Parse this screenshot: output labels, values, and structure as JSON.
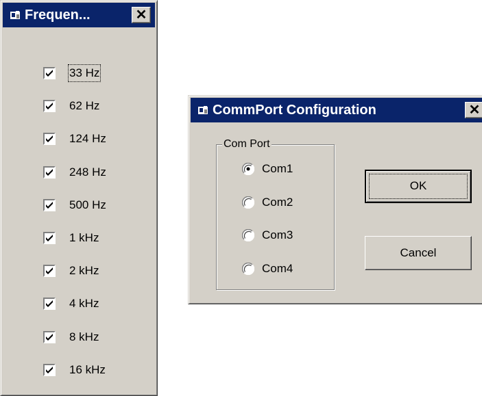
{
  "frequency_window": {
    "title": "Frequen...",
    "items": [
      {
        "label": "33 Hz",
        "checked": true,
        "focused": true
      },
      {
        "label": "62 Hz",
        "checked": true
      },
      {
        "label": "124 Hz",
        "checked": true
      },
      {
        "label": "248 Hz",
        "checked": true
      },
      {
        "label": "500 Hz",
        "checked": true
      },
      {
        "label": "1 kHz",
        "checked": true
      },
      {
        "label": "2 kHz",
        "checked": true
      },
      {
        "label": "4 kHz",
        "checked": true
      },
      {
        "label": "8 kHz",
        "checked": true
      },
      {
        "label": "16 kHz",
        "checked": true
      }
    ]
  },
  "commport_window": {
    "title": "CommPort Configuration",
    "group_label": "Com Port",
    "radios": [
      {
        "label": "Com1",
        "selected": true
      },
      {
        "label": "Com2",
        "selected": false
      },
      {
        "label": "Com3",
        "selected": false
      },
      {
        "label": "Com4",
        "selected": false
      }
    ],
    "ok_label": "OK",
    "cancel_label": "Cancel"
  },
  "colors": {
    "titlebar": "#0a246a",
    "face": "#d4d0c8"
  }
}
